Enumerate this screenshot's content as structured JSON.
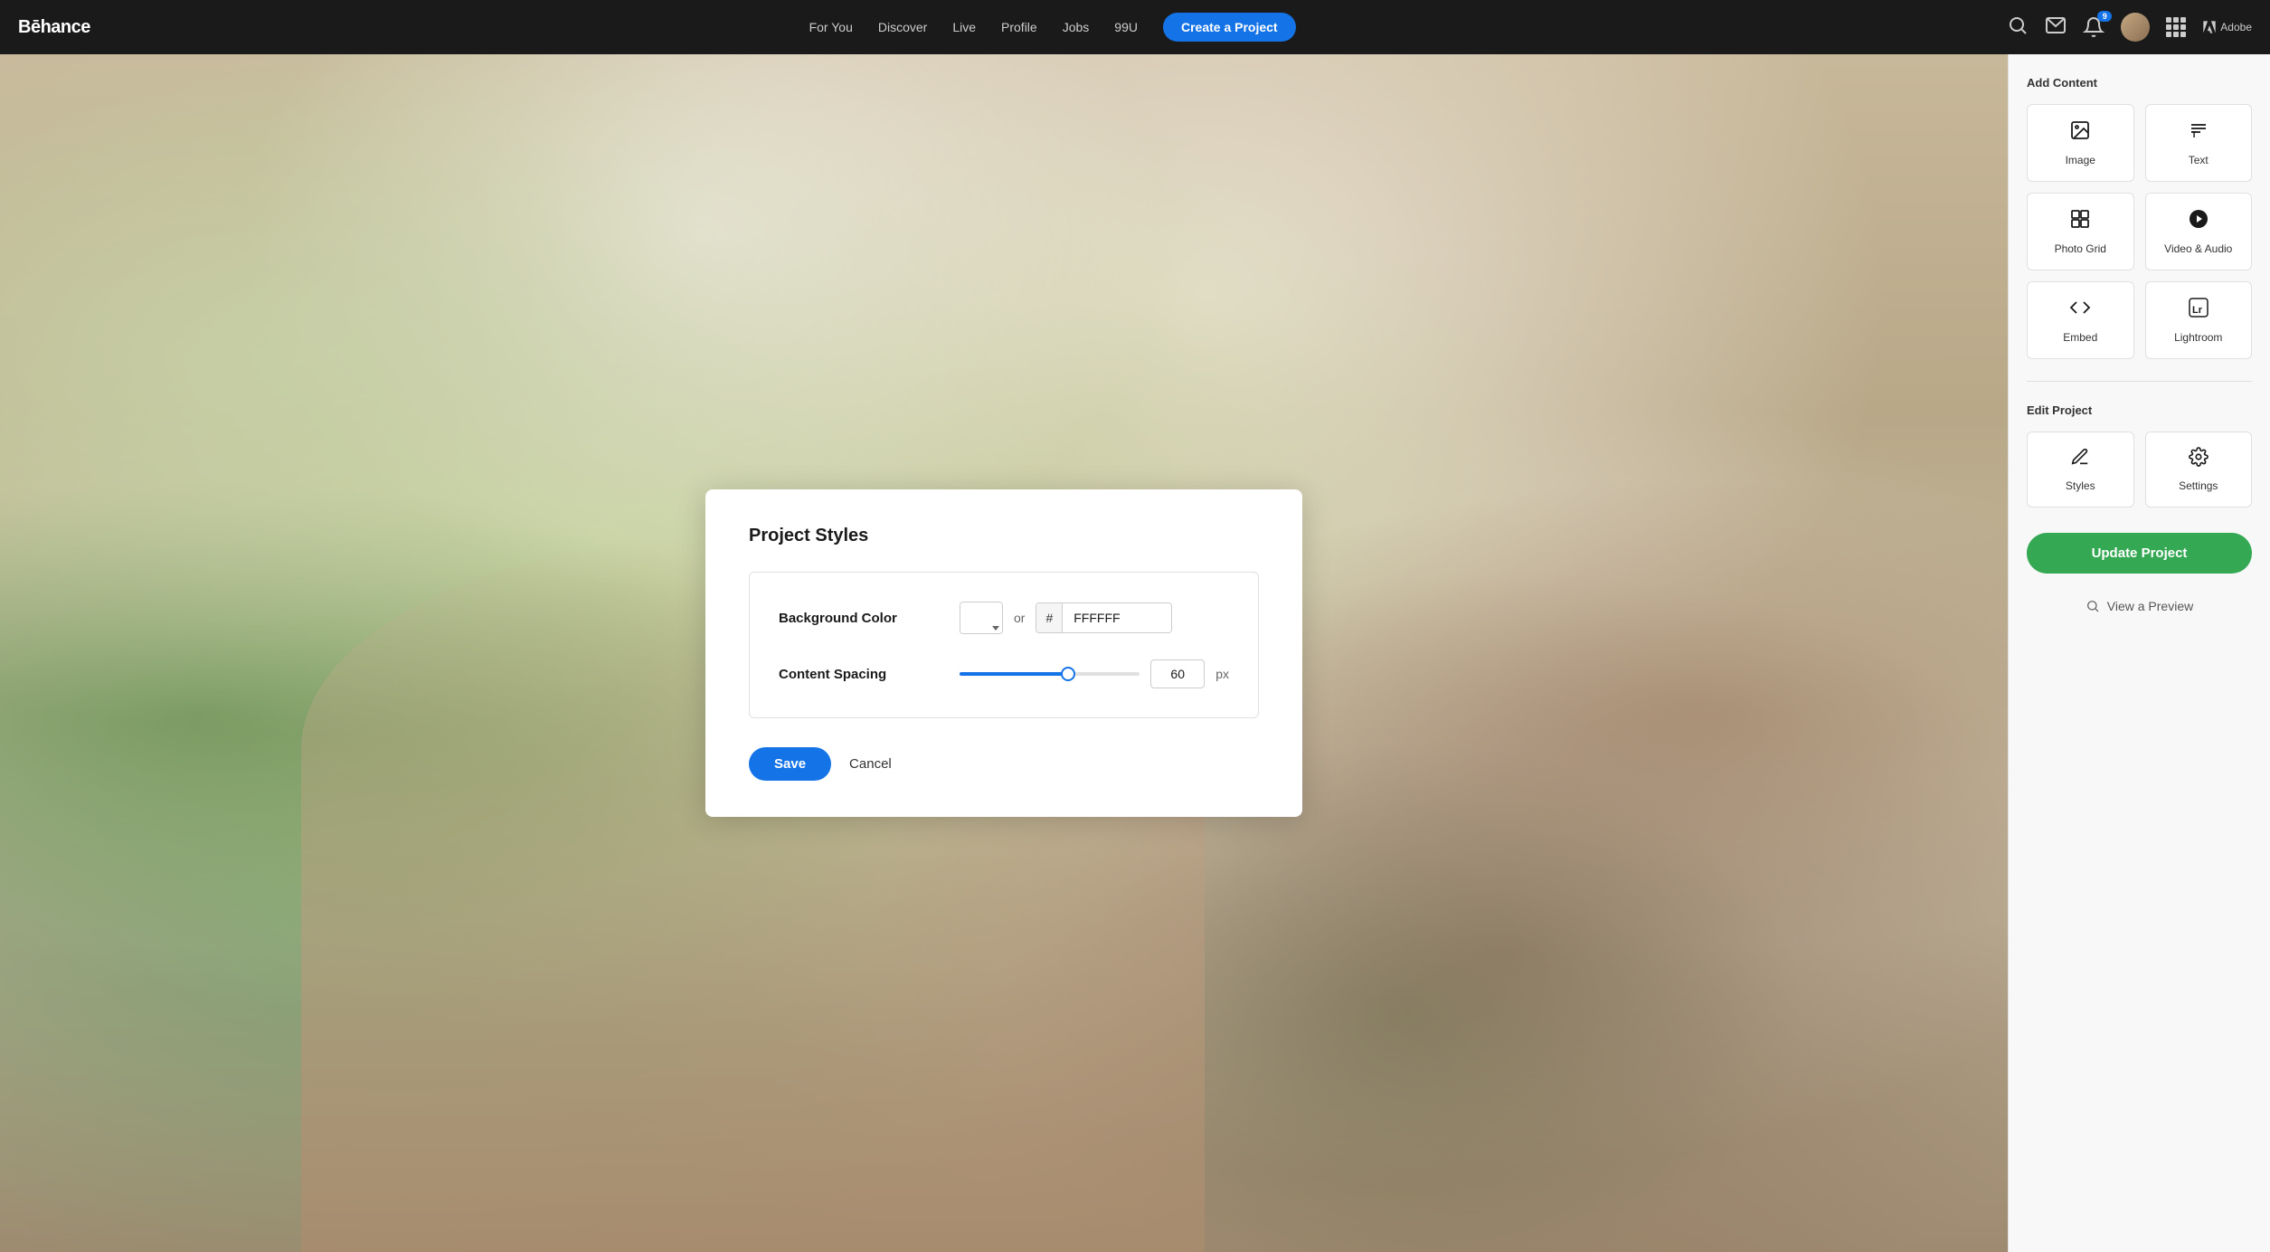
{
  "nav": {
    "logo": "Bēhance",
    "links": [
      "For You",
      "Discover",
      "Live",
      "Profile",
      "Jobs",
      "99U"
    ],
    "cta": "Create a Project",
    "notification_count": "9",
    "adobe_label": "Adobe"
  },
  "modal": {
    "title": "Project Styles",
    "background_color_label": "Background Color",
    "color_value": "FFFFFF",
    "hash_symbol": "#",
    "or_text": "or",
    "content_spacing_label": "Content Spacing",
    "spacing_value": "60",
    "px_label": "px",
    "save_label": "Save",
    "cancel_label": "Cancel"
  },
  "sidebar": {
    "add_content_title": "Add Content",
    "items": [
      {
        "id": "image",
        "label": "Image",
        "icon": "image"
      },
      {
        "id": "text",
        "label": "Text",
        "icon": "text"
      },
      {
        "id": "photo-grid",
        "label": "Photo Grid",
        "icon": "grid"
      },
      {
        "id": "video-audio",
        "label": "Video & Audio",
        "icon": "play"
      },
      {
        "id": "embed",
        "label": "Embed",
        "icon": "embed"
      },
      {
        "id": "lightroom",
        "label": "Lightroom",
        "icon": "lr"
      }
    ],
    "edit_project_title": "Edit Project",
    "edit_items": [
      {
        "id": "styles",
        "label": "Styles",
        "icon": "pen"
      },
      {
        "id": "settings",
        "label": "Settings",
        "icon": "gear"
      }
    ],
    "update_btn": "Update Project",
    "preview_link": "View a Preview"
  }
}
